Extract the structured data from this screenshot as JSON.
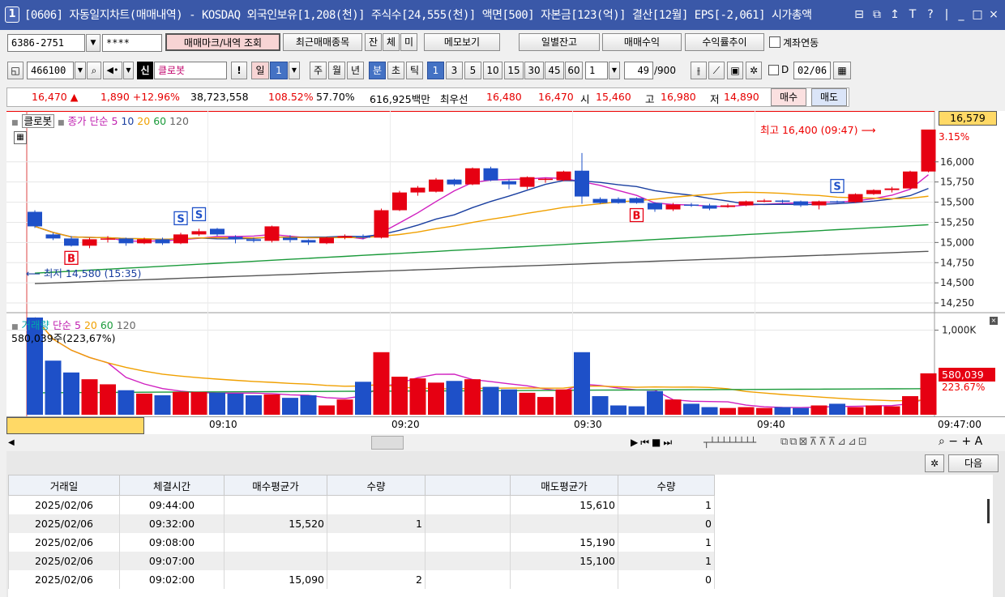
{
  "window": {
    "badge": "1",
    "title": "[0606] 자동일지차트(매매내역) - KOSDAQ 외국인보유[1,208(천)] 주식수[24,555(천)] 액면[500] 자본금[123(억)] 결산[12월] EPS[-2,061] 시가총액",
    "controls": [
      "⊟",
      "⧉",
      "↥",
      "T",
      "?",
      "|",
      "_",
      "□",
      "×"
    ]
  },
  "toolbar1": {
    "account": "6386-2751",
    "password": "****",
    "btn_marks": "매매마크/내역 조회",
    "btn_recent": "최근매매종목",
    "btn_jan": "잔",
    "btn_che": "체",
    "btn_mi": "미",
    "btn_memo": "메모보기",
    "btn_daily_balance": "일별잔고",
    "btn_profit": "매매수익",
    "btn_profit_trend": "수익률추이",
    "chk_account_link": "계좌연동"
  },
  "toolbar2": {
    "code": "466100",
    "sin": "신",
    "stock_name": "클로봇",
    "excl": "!",
    "day": "일",
    "day_n": "1",
    "week": "주",
    "month": "월",
    "year": "년",
    "minute": "분",
    "tick_ch": "초",
    "tick": "틱",
    "intervals": [
      "1",
      "3",
      "5",
      "10",
      "15",
      "30",
      "45",
      "60"
    ],
    "interval_val": "1",
    "count": "49",
    "count_total": "/900",
    "chk_d": "D",
    "date": "02/06"
  },
  "pricebar": {
    "price": "16,470 ▲",
    "change": "1,890 +12.96%",
    "volume": "38,723,558",
    "vol_ratio": "108.52%",
    "strength": "57.70%",
    "amount": "616,925백만",
    "best_label": "최우선",
    "ask": "16,480",
    "bid": "16,470",
    "open_label": "시",
    "open": "15,460",
    "high_label": "고",
    "high": "16,980",
    "low_label": "저",
    "low": "14,890",
    "buy_btn": "매수",
    "sell_btn": "매도"
  },
  "chart_legend": {
    "name": "클로봇",
    "ma_label": "종가 단순",
    "ma_periods": [
      "5",
      "10",
      "20",
      "60",
      "120"
    ],
    "vol_label": "거래량",
    "vol_ma_label": "단순",
    "vol_ma_periods": [
      "5",
      "20",
      "60",
      "120"
    ],
    "vol_info": "580,039주(223,67%)",
    "high_note": "최고 16,400 (09:47)",
    "low_note": "최저 14,580 (15:35)",
    "current_price_tag": "16,579",
    "pct_tag": "3.15%",
    "vol_tag": "580,039",
    "vol_pct_tag": "223.67%"
  },
  "chart_data": {
    "type": "candlestick",
    "price_axis": {
      "ticks": [
        "16,000",
        "15,750",
        "15,500",
        "15,250",
        "15,000",
        "14,750",
        "14,500",
        "14,250"
      ],
      "range": [
        14150,
        16550
      ]
    },
    "volume_axis": {
      "ticks": [
        "1,000K"
      ],
      "range": [
        0,
        1150000
      ]
    },
    "time_ticks": [
      "09:10",
      "09:20",
      "09:30",
      "09:40",
      "09:47:00"
    ],
    "candles": [
      {
        "o": 15380,
        "c": 15200,
        "h": 15400,
        "l": 15180
      },
      {
        "o": 15100,
        "c": 15050,
        "h": 15120,
        "l": 15030
      },
      {
        "o": 15050,
        "c": 14960,
        "h": 15080,
        "l": 14950
      },
      {
        "o": 14960,
        "c": 15040,
        "h": 15060,
        "l": 14930
      },
      {
        "o": 15040,
        "c": 15050,
        "h": 15080,
        "l": 15000
      },
      {
        "o": 15050,
        "c": 14990,
        "h": 15060,
        "l": 14960
      },
      {
        "o": 14990,
        "c": 15040,
        "h": 15060,
        "l": 14980
      },
      {
        "o": 15040,
        "c": 14990,
        "h": 15060,
        "l": 14970
      },
      {
        "o": 14990,
        "c": 15100,
        "h": 15120,
        "l": 14980
      },
      {
        "o": 15100,
        "c": 15140,
        "h": 15170,
        "l": 15080
      },
      {
        "o": 15170,
        "c": 15100,
        "h": 15180,
        "l": 15080
      },
      {
        "o": 15070,
        "c": 15040,
        "h": 15090,
        "l": 14990
      },
      {
        "o": 15040,
        "c": 15020,
        "h": 15060,
        "l": 15000
      },
      {
        "o": 15020,
        "c": 15200,
        "h": 15210,
        "l": 15000
      },
      {
        "o": 15060,
        "c": 15030,
        "h": 15090,
        "l": 15000
      },
      {
        "o": 15030,
        "c": 15000,
        "h": 15040,
        "l": 14970
      },
      {
        "o": 14990,
        "c": 15060,
        "h": 15070,
        "l": 14980
      },
      {
        "o": 15060,
        "c": 15080,
        "h": 15100,
        "l": 15040
      },
      {
        "o": 15080,
        "c": 15060,
        "h": 15100,
        "l": 15040
      },
      {
        "o": 15060,
        "c": 15400,
        "h": 15420,
        "l": 15050
      },
      {
        "o": 15400,
        "c": 15620,
        "h": 15640,
        "l": 15390
      },
      {
        "o": 15620,
        "c": 15680,
        "h": 15700,
        "l": 15580
      },
      {
        "o": 15630,
        "c": 15780,
        "h": 15800,
        "l": 15620
      },
      {
        "o": 15780,
        "c": 15720,
        "h": 15790,
        "l": 15700
      },
      {
        "o": 15720,
        "c": 15920,
        "h": 15930,
        "l": 15710
      },
      {
        "o": 15920,
        "c": 15770,
        "h": 15940,
        "l": 15760
      },
      {
        "o": 15760,
        "c": 15720,
        "h": 15780,
        "l": 15660
      },
      {
        "o": 15690,
        "c": 15810,
        "h": 15820,
        "l": 15660
      },
      {
        "o": 15780,
        "c": 15790,
        "h": 15800,
        "l": 15740
      },
      {
        "o": 15770,
        "c": 15880,
        "h": 15890,
        "l": 15760
      },
      {
        "o": 15890,
        "c": 15570,
        "h": 16110,
        "l": 15480
      },
      {
        "o": 15540,
        "c": 15490,
        "h": 15560,
        "l": 15480
      },
      {
        "o": 15540,
        "c": 15490,
        "h": 15560,
        "l": 15480
      },
      {
        "o": 15550,
        "c": 15490,
        "h": 15560,
        "l": 15480
      },
      {
        "o": 15490,
        "c": 15410,
        "h": 15500,
        "l": 15380
      },
      {
        "o": 15410,
        "c": 15470,
        "h": 15490,
        "l": 15390
      },
      {
        "o": 15470,
        "c": 15460,
        "h": 15490,
        "l": 15440
      },
      {
        "o": 15460,
        "c": 15420,
        "h": 15480,
        "l": 15400
      },
      {
        "o": 15440,
        "c": 15460,
        "h": 15480,
        "l": 15430
      },
      {
        "o": 15460,
        "c": 15510,
        "h": 15520,
        "l": 15450
      },
      {
        "o": 15510,
        "c": 15520,
        "h": 15540,
        "l": 15500
      },
      {
        "o": 15520,
        "c": 15510,
        "h": 15530,
        "l": 15490
      },
      {
        "o": 15510,
        "c": 15460,
        "h": 15520,
        "l": 15440
      },
      {
        "o": 15460,
        "c": 15510,
        "h": 15520,
        "l": 15410
      },
      {
        "o": 15510,
        "c": 15500,
        "h": 15520,
        "l": 15490
      },
      {
        "o": 15500,
        "c": 15600,
        "h": 15610,
        "l": 15490
      },
      {
        "o": 15600,
        "c": 15650,
        "h": 15660,
        "l": 15590
      },
      {
        "o": 15650,
        "c": 15670,
        "h": 15690,
        "l": 15620
      },
      {
        "o": 15670,
        "c": 15880,
        "h": 15890,
        "l": 15660
      },
      {
        "o": 15880,
        "c": 16400,
        "h": 16400,
        "l": 15870
      }
    ],
    "volumes": [
      1150000,
      640000,
      500000,
      420000,
      360000,
      290000,
      250000,
      230000,
      270000,
      270000,
      260000,
      250000,
      230000,
      240000,
      200000,
      230000,
      110000,
      180000,
      390000,
      740000,
      450000,
      430000,
      380000,
      400000,
      420000,
      330000,
      300000,
      260000,
      210000,
      300000,
      740000,
      220000,
      110000,
      100000,
      280000,
      180000,
      130000,
      90000,
      80000,
      90000,
      80000,
      90000,
      80000,
      110000,
      130000,
      90000,
      110000,
      100000,
      220000,
      490000
    ],
    "markers": [
      {
        "type": "B",
        "index": 2
      },
      {
        "type": "S",
        "index": 8
      },
      {
        "type": "S",
        "index": 9
      },
      {
        "type": "B",
        "index": 33
      },
      {
        "type": "S",
        "index": 44
      }
    ],
    "ma_lines": [
      {
        "period": "5",
        "color": "#d020c0"
      },
      {
        "period": "10",
        "color": "#1a3fa0"
      },
      {
        "period": "20",
        "color": "#f0a000"
      },
      {
        "period": "60",
        "color": "#1a9a3a"
      },
      {
        "period": "120",
        "color": "#555555"
      }
    ]
  },
  "bottom_panel": {
    "next_btn": "다음",
    "headers": [
      "거래일",
      "체결시간",
      "매수평균가",
      "수량",
      "",
      "매도평균가",
      "수량"
    ],
    "rows": [
      [
        "2025/02/06",
        "09:44:00",
        "",
        "",
        "",
        "15,610",
        "1"
      ],
      [
        "2025/02/06",
        "09:32:00",
        "15,520",
        "1",
        "",
        "",
        "0"
      ],
      [
        "2025/02/06",
        "09:08:00",
        "",
        "",
        "",
        "15,190",
        "1"
      ],
      [
        "2025/02/06",
        "09:07:00",
        "",
        "",
        "",
        "15,100",
        "1"
      ],
      [
        "2025/02/06",
        "09:02:00",
        "15,090",
        "2",
        "",
        "",
        "0"
      ]
    ]
  },
  "colors": {
    "up": "#e60012",
    "down": "#1e50c8",
    "title_bg": "#3a58a8",
    "accent_sel": "#4472c4"
  }
}
